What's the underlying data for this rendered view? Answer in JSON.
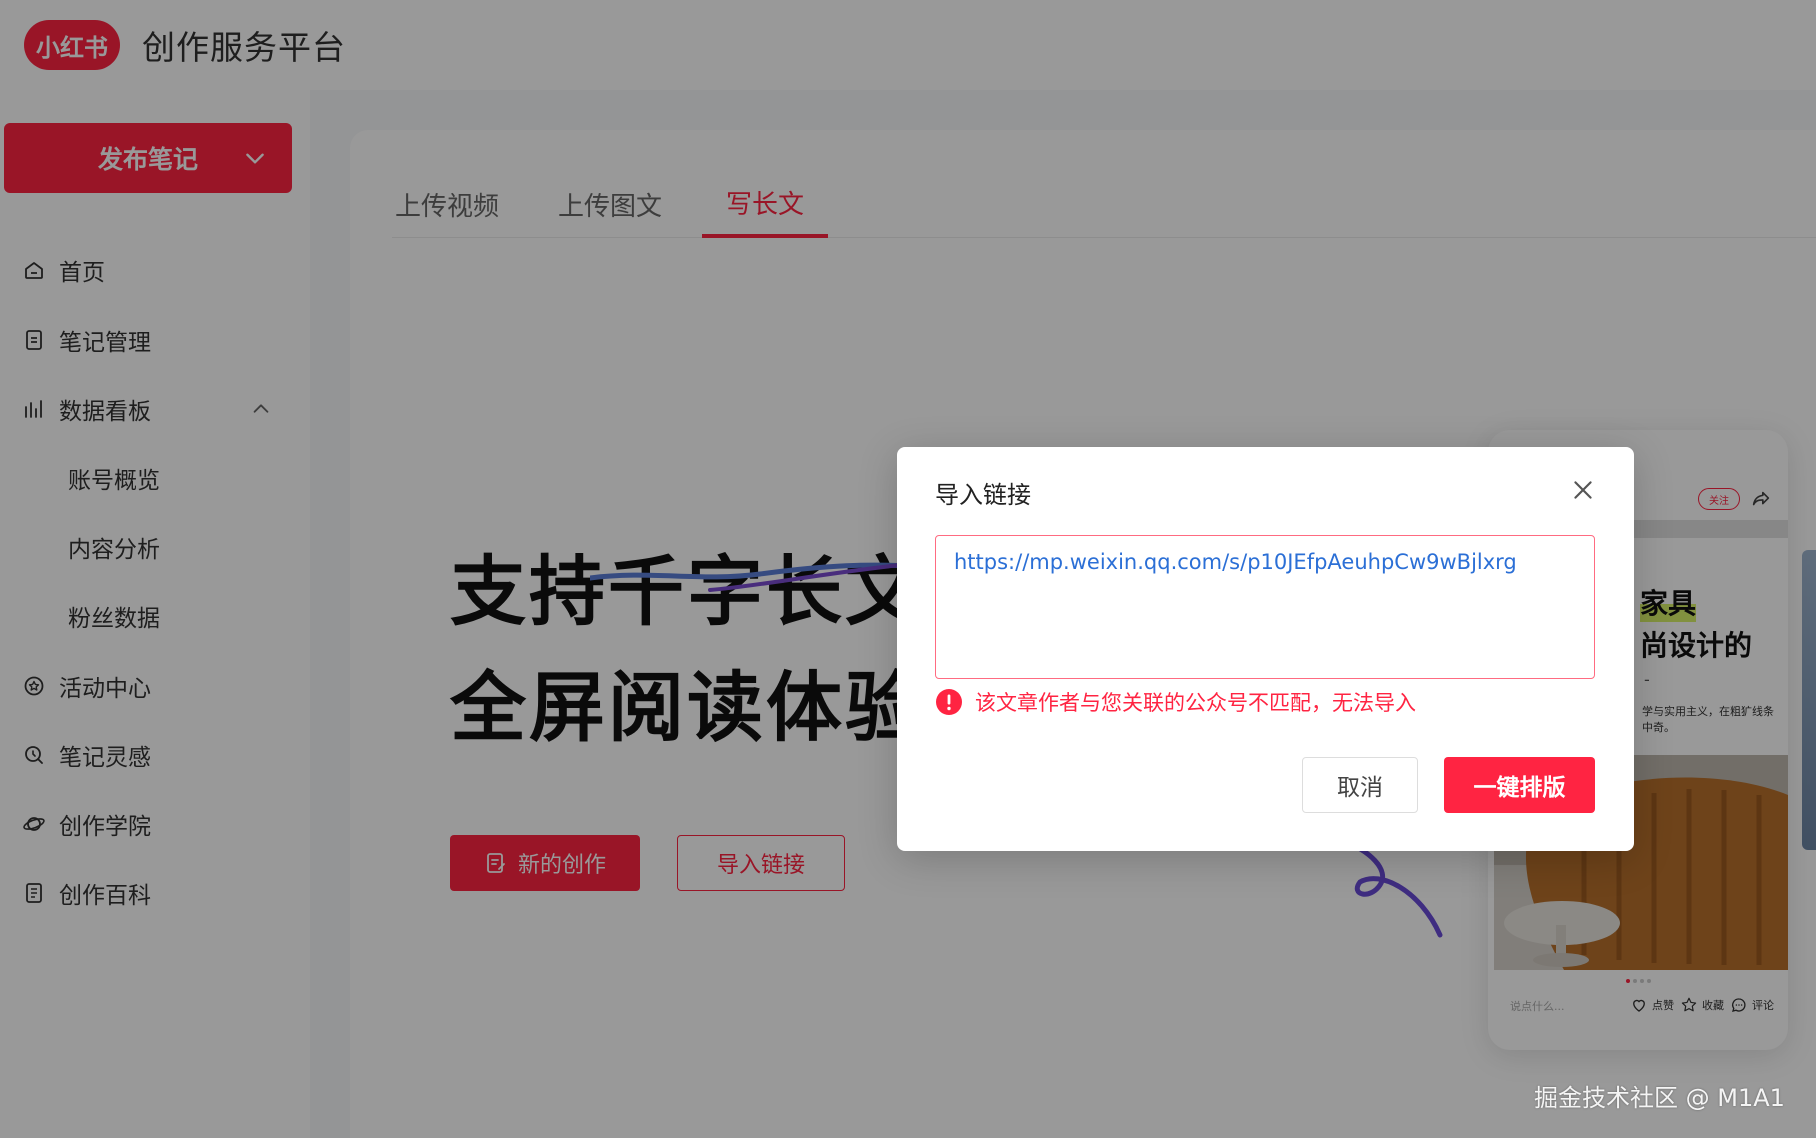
{
  "header": {
    "logo_text": "小红书",
    "platform_title": "创作服务平台"
  },
  "sidebar": {
    "publish_label": "发布笔记",
    "items": [
      {
        "label": "首页",
        "icon": "home-icon"
      },
      {
        "label": "笔记管理",
        "icon": "note-icon"
      },
      {
        "label": "数据看板",
        "icon": "bar-chart-icon",
        "expanded": true
      },
      {
        "label": "账号概览"
      },
      {
        "label": "内容分析"
      },
      {
        "label": "粉丝数据"
      },
      {
        "label": "活动中心",
        "icon": "activity-icon"
      },
      {
        "label": "笔记灵感",
        "icon": "inspiration-icon"
      },
      {
        "label": "创作学院",
        "icon": "academy-icon"
      },
      {
        "label": "创作百科",
        "icon": "encyclopedia-icon"
      }
    ]
  },
  "main": {
    "tabs": [
      {
        "label": "上传视频",
        "active": false
      },
      {
        "label": "上传图文",
        "active": false
      },
      {
        "label": "写长文",
        "active": true
      }
    ],
    "hero": {
      "line1": "支持千字长文",
      "line2": "全屏阅读体验"
    },
    "new_button_label": "新的创作",
    "import_button_label": "导入链接",
    "preview": {
      "follow_label": "关注",
      "headline1": "家具",
      "headline2": "尚设计的",
      "dash": "-",
      "desc": "学与实用主义，在粗犷线条中奇。",
      "comment_placeholder": "说点什么...",
      "like_label": "点赞",
      "fav_label": "收藏",
      "comment_label": "评论"
    }
  },
  "modal": {
    "title": "导入链接",
    "link_value": "https://mp.weixin.qq.com/s/p10JEfpAeuhpCw9wBjlxrg",
    "error_text": "该文章作者与您关联的公众号不匹配，无法导入",
    "cancel_label": "取消",
    "confirm_label": "一键排版"
  },
  "watermark": "掘金技术社区 @ M1A1",
  "colors": {
    "brand": "#ff2442",
    "link": "#2b6fd6",
    "overlay": "rgba(0,0,0,0.4)"
  }
}
